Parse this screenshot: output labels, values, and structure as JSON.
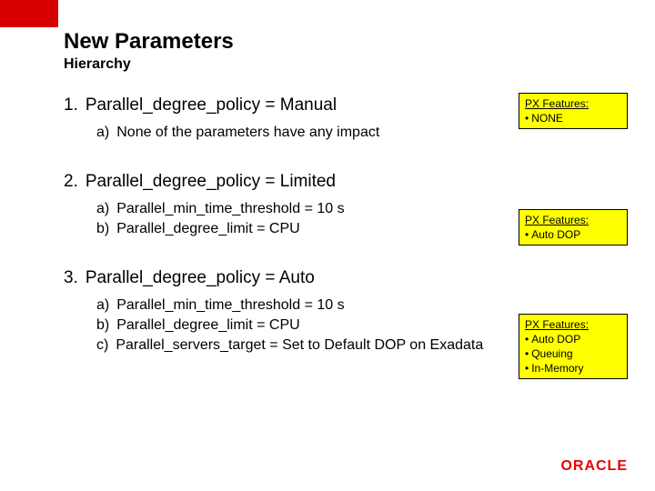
{
  "title": "New Parameters",
  "subtitle": "Hierarchy",
  "items": [
    {
      "num": "1.",
      "text": "Parallel_degree_policy = Manual",
      "subs": [
        {
          "letter": "a)",
          "text": "None of the parameters have any impact"
        }
      ]
    },
    {
      "num": "2.",
      "text": "Parallel_degree_policy = Limited",
      "subs": [
        {
          "letter": "a)",
          "text": "Parallel_min_time_threshold = 10 s"
        },
        {
          "letter": "b)",
          "text": "Parallel_degree_limit = CPU"
        }
      ]
    },
    {
      "num": "3.",
      "text": "Parallel_degree_policy = Auto",
      "subs": [
        {
          "letter": "a)",
          "text": "Parallel_min_time_threshold = 10 s"
        },
        {
          "letter": "b)",
          "text": "Parallel_degree_limit = CPU"
        },
        {
          "letter": "c)",
          "text": "Parallel_servers_target = Set to Default DOP on Exadata"
        }
      ]
    }
  ],
  "callouts": [
    {
      "header": "PX Features:",
      "lines": [
        "NONE"
      ]
    },
    {
      "header": "PX Features:",
      "lines": [
        "Auto DOP"
      ]
    },
    {
      "header": "PX Features:",
      "lines": [
        "Auto DOP",
        "Queuing",
        "In-Memory"
      ]
    }
  ],
  "logo": "ORACLE",
  "bullet": "•"
}
